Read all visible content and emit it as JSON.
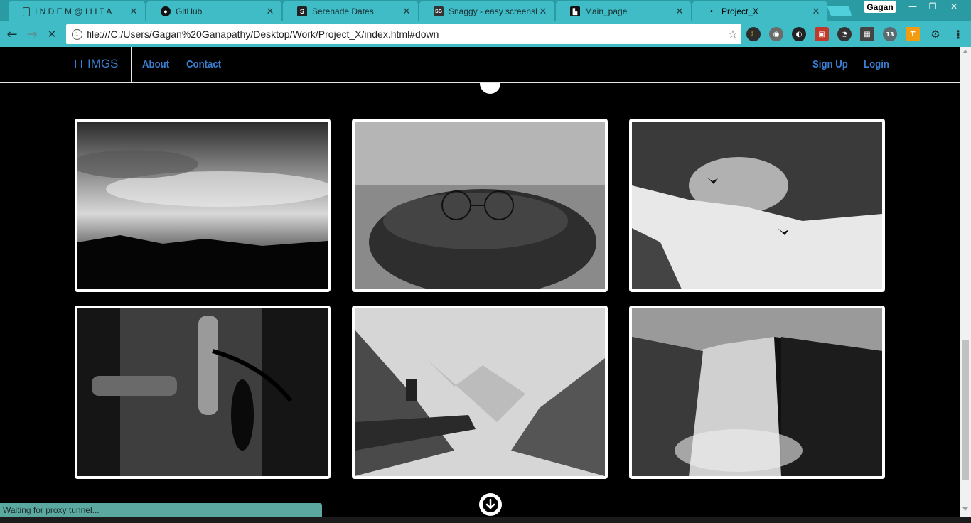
{
  "browser": {
    "tabs": [
      {
        "title": "I N D E M @ I I I T A",
        "favicon": "doc-icon",
        "active": false
      },
      {
        "title": "GitHub",
        "favicon": "github-icon",
        "active": false
      },
      {
        "title": "Serenade Dates",
        "favicon": "s-icon",
        "active": false
      },
      {
        "title": "Snaggy - easy screensho",
        "favicon": "sg-icon",
        "active": false
      },
      {
        "title": "Main_page",
        "favicon": "page-icon",
        "active": false
      },
      {
        "title": "Project_X",
        "favicon": "dot-icon",
        "active": true
      }
    ],
    "close_glyph": "✕",
    "profile_name": "Gagan",
    "window_controls": {
      "minimize": "—",
      "restore": "❐",
      "close": "✕"
    },
    "address": "file:///C:/Users/Gagan%20Ganapathy/Desktop/Work/Project_X/index.html#down",
    "info_glyph": "i",
    "star_glyph": "☆",
    "back_glyph": "←",
    "forward_glyph": "→",
    "stop_glyph": "✕",
    "extensions": [
      {
        "name": "moon-ext-icon",
        "glyph": "☾",
        "color": "#2c2c2c"
      },
      {
        "name": "color-ext-icon",
        "glyph": "◉",
        "color": "#6b6b6b"
      },
      {
        "name": "contrast-ext-icon",
        "glyph": "◐",
        "color": "#222222"
      },
      {
        "name": "clip-ext-icon",
        "glyph": "▣",
        "color": "#c0392b"
      },
      {
        "name": "speed-ext-icon",
        "glyph": "◔",
        "color": "#333333"
      },
      {
        "name": "film-ext-icon",
        "glyph": "▦",
        "color": "#444444"
      },
      {
        "name": "weather-ext-icon",
        "glyph": "13",
        "color": "#5a6b70"
      },
      {
        "name": "orange-ext-icon",
        "glyph": "T",
        "color": "#f39c12"
      },
      {
        "name": "gear-icon",
        "glyph": "⚙",
        "color": "#3a3a3a"
      },
      {
        "name": "menu-icon",
        "glyph": "⋮",
        "color": "#3a3a3a"
      }
    ],
    "status_text": "Waiting for proxy tunnel..."
  },
  "site": {
    "brand": "IMGS",
    "nav_left": [
      "About",
      "Contact"
    ],
    "nav_right": [
      "Sign Up",
      "Login"
    ],
    "accent": "#3a7fd3",
    "gallery": [
      {
        "name": "cloudy-sky-photo"
      },
      {
        "name": "glasses-on-hat-photo"
      },
      {
        "name": "snowy-mountain-birds-photo"
      },
      {
        "name": "studio-microphone-photo"
      },
      {
        "name": "jumping-at-overlook-photo"
      },
      {
        "name": "waterfall-photo"
      }
    ]
  }
}
